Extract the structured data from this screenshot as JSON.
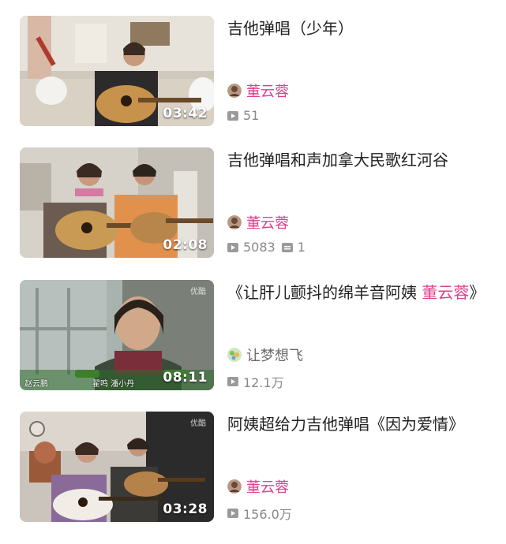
{
  "videos": [
    {
      "title": "吉他弹唱（少年）",
      "title_highlight": "",
      "title_suffix": "",
      "duration": "03:42",
      "author": "董云蓉",
      "author_highlighted": true,
      "views": "51",
      "comments": ""
    },
    {
      "title": "吉他弹唱和声加拿大民歌红河谷",
      "title_highlight": "",
      "title_suffix": "",
      "duration": "02:08",
      "author": "董云蓉",
      "author_highlighted": true,
      "views": "5083",
      "comments": "1"
    },
    {
      "title": "《让肝儿颤抖的绵羊音阿姨 ",
      "title_highlight": "董云蓉",
      "title_suffix": "》",
      "duration": "08:11",
      "author": "让梦想飞",
      "author_highlighted": false,
      "views": "12.1万",
      "comments": "",
      "thumb_logo": "优酷",
      "thumb_caption_left": "赵云鹏",
      "thumb_caption_right": "翟鸣 潘小丹"
    },
    {
      "title": "阿姨超给力吉他弹唱《因为爱情》",
      "title_highlight": "",
      "title_suffix": "",
      "duration": "03:28",
      "author": "董云蓉",
      "author_highlighted": true,
      "views": "156.0万",
      "comments": "",
      "thumb_logo": "优酷"
    }
  ],
  "colors": {
    "accent": "#e0408e",
    "meta": "#888888",
    "title": "#222222"
  },
  "icons": {
    "views": "play-count-icon",
    "comments": "comment-count-icon"
  }
}
